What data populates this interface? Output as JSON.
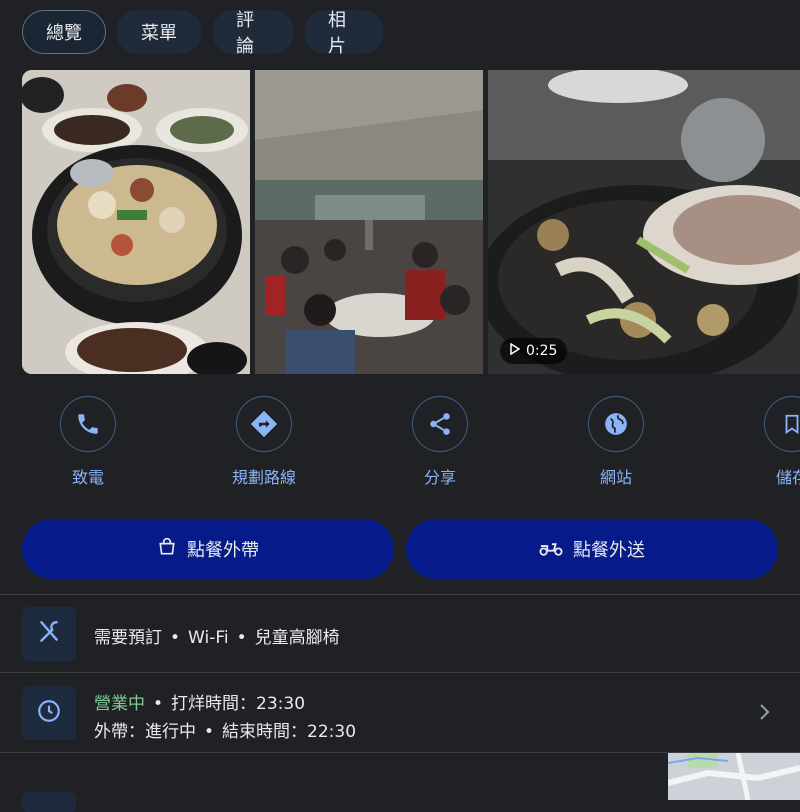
{
  "tabs": [
    {
      "label": "總覽",
      "active": true
    },
    {
      "label": "菜單",
      "active": false
    },
    {
      "label": "評論",
      "active": false
    },
    {
      "label": "相片",
      "active": false
    }
  ],
  "photos": {
    "video_duration": "0:25"
  },
  "actions": [
    {
      "label": "致電",
      "icon": "phone-icon"
    },
    {
      "label": "規劃路線",
      "icon": "directions-icon"
    },
    {
      "label": "分享",
      "icon": "share-icon"
    },
    {
      "label": "網站",
      "icon": "globe-icon"
    },
    {
      "label": "儲存",
      "icon": "bookmark-icon"
    }
  ],
  "order_buttons": {
    "takeout": "點餐外帶",
    "delivery": "點餐外送"
  },
  "amenities": {
    "items": [
      "需要預訂",
      "Wi-Fi",
      "兒童高腳椅"
    ],
    "separator": "•"
  },
  "hours": {
    "status": "營業中",
    "closing": "打烊時間：23:30",
    "takeout_line": "外帶：進行中",
    "takeout_end": "結束時間：22:30"
  },
  "colors": {
    "background": "#202124",
    "accent_blue": "#8ab4f8",
    "button_blue": "#061a8a",
    "open_green": "#81c995"
  }
}
